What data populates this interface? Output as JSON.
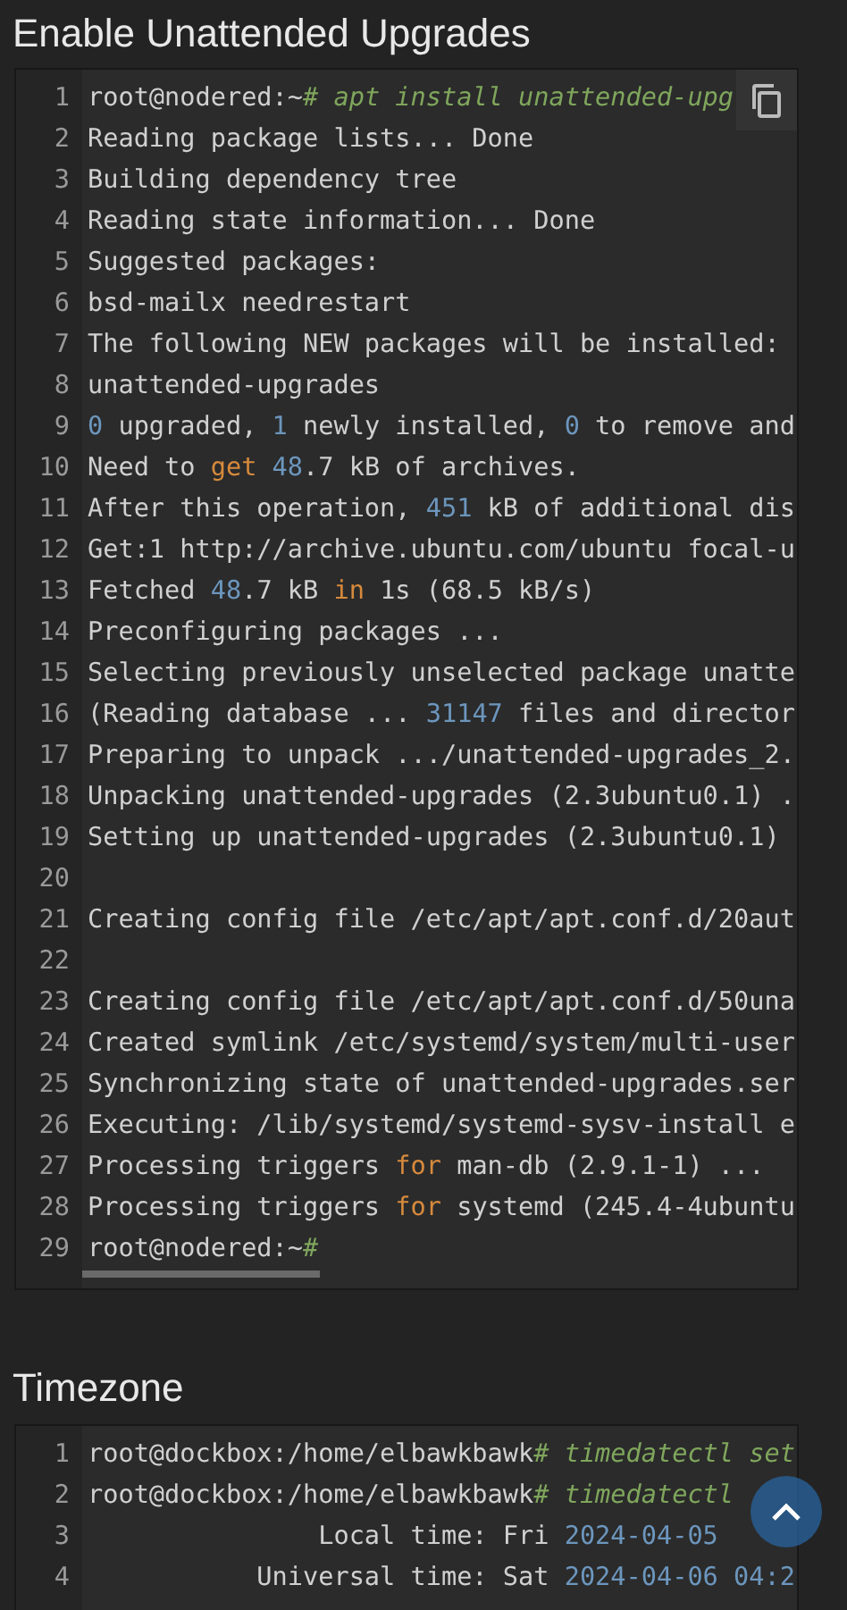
{
  "sections": [
    {
      "title": "Enable Unattended Upgrades",
      "copy_button": true,
      "scrollbar": true,
      "lines": [
        {
          "n": "1",
          "tokens": [
            {
              "kind": "text",
              "text": "root@nodered:~"
            },
            {
              "kind": "comment",
              "text": "# apt install unattended-upg"
            }
          ]
        },
        {
          "n": "2",
          "tokens": [
            {
              "kind": "text",
              "text": "Reading package lists... Done"
            }
          ]
        },
        {
          "n": "3",
          "tokens": [
            {
              "kind": "text",
              "text": "Building dependency tree"
            }
          ]
        },
        {
          "n": "4",
          "tokens": [
            {
              "kind": "text",
              "text": "Reading state information... Done"
            }
          ]
        },
        {
          "n": "5",
          "tokens": [
            {
              "kind": "text",
              "text": "Suggested packages:"
            }
          ]
        },
        {
          "n": "6",
          "tokens": [
            {
              "kind": "text",
              "text": "bsd-mailx needrestart"
            }
          ]
        },
        {
          "n": "7",
          "tokens": [
            {
              "kind": "text",
              "text": "The following NEW packages will be installed:"
            }
          ]
        },
        {
          "n": "8",
          "tokens": [
            {
              "kind": "text",
              "text": "unattended-upgrades"
            }
          ]
        },
        {
          "n": "9",
          "tokens": [
            {
              "kind": "number",
              "text": "0"
            },
            {
              "kind": "text",
              "text": " upgraded, "
            },
            {
              "kind": "number",
              "text": "1"
            },
            {
              "kind": "text",
              "text": " newly installed, "
            },
            {
              "kind": "number",
              "text": "0"
            },
            {
              "kind": "text",
              "text": " to remove and"
            }
          ]
        },
        {
          "n": "10",
          "tokens": [
            {
              "kind": "text",
              "text": "Need to "
            },
            {
              "kind": "keyword",
              "text": "get"
            },
            {
              "kind": "number",
              "text": " 48"
            },
            {
              "kind": "text",
              "text": ".7 kB of archives."
            }
          ]
        },
        {
          "n": "11",
          "tokens": [
            {
              "kind": "text",
              "text": "After this operation, "
            },
            {
              "kind": "number",
              "text": "451"
            },
            {
              "kind": "text",
              "text": " kB of additional dis"
            }
          ]
        },
        {
          "n": "12",
          "tokens": [
            {
              "kind": "text",
              "text": "Get:1 http://archive.ubuntu.com/ubuntu focal-u"
            }
          ]
        },
        {
          "n": "13",
          "tokens": [
            {
              "kind": "text",
              "text": "Fetched "
            },
            {
              "kind": "number",
              "text": "48"
            },
            {
              "kind": "text",
              "text": ".7 kB "
            },
            {
              "kind": "keyword",
              "text": "in"
            },
            {
              "kind": "text",
              "text": " 1s (68.5 kB/s)"
            }
          ]
        },
        {
          "n": "14",
          "tokens": [
            {
              "kind": "text",
              "text": "Preconfiguring packages ..."
            }
          ]
        },
        {
          "n": "15",
          "tokens": [
            {
              "kind": "text",
              "text": "Selecting previously unselected package unatte"
            }
          ]
        },
        {
          "n": "16",
          "tokens": [
            {
              "kind": "text",
              "text": "(Reading database ... "
            },
            {
              "kind": "number",
              "text": "31147"
            },
            {
              "kind": "text",
              "text": " files and director"
            }
          ]
        },
        {
          "n": "17",
          "tokens": [
            {
              "kind": "text",
              "text": "Preparing to unpack .../unattended-upgrades_2."
            }
          ]
        },
        {
          "n": "18",
          "tokens": [
            {
              "kind": "text",
              "text": "Unpacking unattended-upgrades (2.3ubuntu0.1) ."
            }
          ]
        },
        {
          "n": "19",
          "tokens": [
            {
              "kind": "text",
              "text": "Setting up unattended-upgrades (2.3ubuntu0.1)"
            }
          ]
        },
        {
          "n": "20"
        },
        {
          "n": "21",
          "tokens": [
            {
              "kind": "text",
              "text": "Creating config file /etc/apt/apt.conf.d/20aut"
            }
          ]
        },
        {
          "n": "22"
        },
        {
          "n": "23",
          "tokens": [
            {
              "kind": "text",
              "text": "Creating config file /etc/apt/apt.conf.d/50una"
            }
          ]
        },
        {
          "n": "24",
          "tokens": [
            {
              "kind": "text",
              "text": "Created symlink /etc/systemd/system/multi-user"
            }
          ]
        },
        {
          "n": "25",
          "tokens": [
            {
              "kind": "text",
              "text": "Synchronizing state of unattended-upgrades.ser"
            }
          ]
        },
        {
          "n": "26",
          "tokens": [
            {
              "kind": "text",
              "text": "Executing: /lib/systemd/systemd-sysv-install e"
            }
          ]
        },
        {
          "n": "27",
          "tokens": [
            {
              "kind": "text",
              "text": "Processing triggers "
            },
            {
              "kind": "keyword",
              "text": "for"
            },
            {
              "kind": "text",
              "text": " man-db (2.9.1-1) ..."
            }
          ]
        },
        {
          "n": "28",
          "tokens": [
            {
              "kind": "text",
              "text": "Processing triggers "
            },
            {
              "kind": "keyword",
              "text": "for"
            },
            {
              "kind": "text",
              "text": " systemd (245.4-4ubuntu"
            }
          ]
        },
        {
          "n": "29",
          "tokens": [
            {
              "kind": "text",
              "text": "root@nodered:~"
            },
            {
              "kind": "comment",
              "text": "#"
            }
          ]
        }
      ]
    },
    {
      "title": "Timezone",
      "lines": [
        {
          "n": "1",
          "tokens": [
            {
              "kind": "text",
              "text": "root@dockbox:/home/elbawkbawk"
            },
            {
              "kind": "comment",
              "text": "# timedatectl set"
            }
          ]
        },
        {
          "n": "2",
          "tokens": [
            {
              "kind": "text",
              "text": "root@dockbox:/home/elbawkbawk"
            },
            {
              "kind": "comment",
              "text": "# timedatectl"
            }
          ]
        },
        {
          "n": "3",
          "tokens": [
            {
              "kind": "text",
              "text": "               Local time: Fri "
            },
            {
              "kind": "number",
              "text": "2024-04-05"
            }
          ]
        },
        {
          "n": "4",
          "tokens": [
            {
              "kind": "text",
              "text": "           Universal time: Sat "
            },
            {
              "kind": "number",
              "text": "2024-04-06 04:2"
            }
          ]
        }
      ]
    }
  ],
  "back_to_top": true
}
